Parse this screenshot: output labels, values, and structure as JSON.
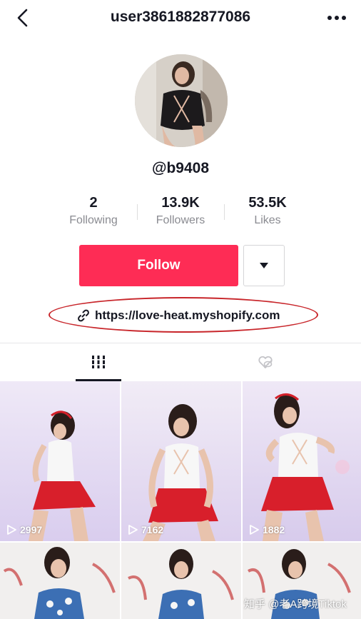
{
  "header": {
    "title": "user3861882877086",
    "back_icon": "back-chevron-icon",
    "more_icon": "more-dots-icon"
  },
  "profile": {
    "handle": "@b9408",
    "avatar": "profile-avatar"
  },
  "stats": [
    {
      "value": "2",
      "label": "Following"
    },
    {
      "value": "13.9K",
      "label": "Followers"
    },
    {
      "value": "53.5K",
      "label": "Likes"
    }
  ],
  "actions": {
    "follow_label": "Follow",
    "follow_color": "#fe2c55",
    "dropdown_icon": "caret-down-icon"
  },
  "bio": {
    "link_text": "https://love-heat.myshopify.com",
    "link_icon": "link-icon",
    "annotation_color": "#c8252a"
  },
  "tabs": [
    {
      "icon": "videos-grid-icon",
      "active": true
    },
    {
      "icon": "liked-hidden-icon",
      "active": false
    }
  ],
  "videos": [
    {
      "views": "2997"
    },
    {
      "views": "7162"
    },
    {
      "views": "1882"
    },
    {
      "views": ""
    },
    {
      "views": ""
    },
    {
      "views": ""
    }
  ],
  "watermark": "知乎 @老A跨境Tiktok"
}
